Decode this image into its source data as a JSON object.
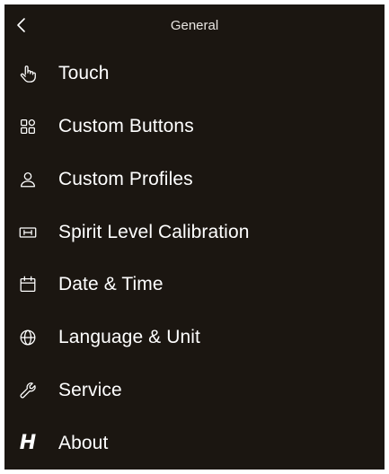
{
  "header": {
    "title": "General",
    "back_icon": "chevron-left-icon"
  },
  "menu": {
    "items": [
      {
        "label": "Touch",
        "icon": "touch-hand-icon"
      },
      {
        "label": "Custom Buttons",
        "icon": "grid-buttons-icon"
      },
      {
        "label": "Custom Profiles",
        "icon": "person-icon"
      },
      {
        "label": "Spirit Level Calibration",
        "icon": "spirit-level-icon"
      },
      {
        "label": "Date & Time",
        "icon": "calendar-icon"
      },
      {
        "label": "Language & Unit",
        "icon": "globe-icon"
      },
      {
        "label": "Service",
        "icon": "wrench-icon"
      },
      {
        "label": "About",
        "icon": "brand-h-icon",
        "glyph": "H"
      }
    ]
  },
  "colors": {
    "background": "#1b1611",
    "text": "#ffffff",
    "title_text": "#e9e6e2"
  }
}
